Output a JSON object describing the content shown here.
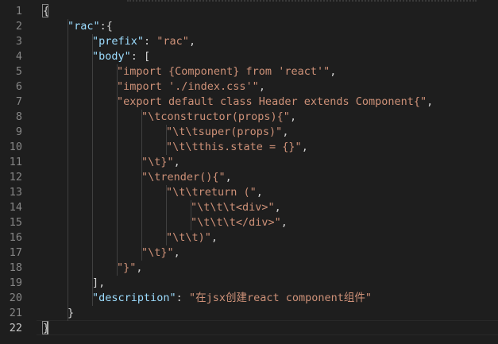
{
  "editor": {
    "line_numbers": [
      "1",
      "2",
      "3",
      "4",
      "5",
      "6",
      "7",
      "8",
      "9",
      "10",
      "11",
      "12",
      "13",
      "14",
      "15",
      "16",
      "17",
      "18",
      "19",
      "20",
      "21",
      "22"
    ],
    "active_line": "22",
    "lines": [
      {
        "indent": 0,
        "tokens": [
          {
            "t": "{",
            "c": "p"
          }
        ]
      },
      {
        "indent": 1,
        "tokens": [
          {
            "t": "\"rac\"",
            "c": "k"
          },
          {
            "t": ":{",
            "c": "p"
          }
        ]
      },
      {
        "indent": 2,
        "tokens": [
          {
            "t": "\"prefix\"",
            "c": "k"
          },
          {
            "t": ": ",
            "c": "p"
          },
          {
            "t": "\"rac\"",
            "c": "s"
          },
          {
            "t": ",",
            "c": "p"
          }
        ]
      },
      {
        "indent": 2,
        "tokens": [
          {
            "t": "\"body\"",
            "c": "k"
          },
          {
            "t": ": [",
            "c": "p"
          }
        ]
      },
      {
        "indent": 3,
        "tokens": [
          {
            "t": "\"import {Component} from 'react'\"",
            "c": "s"
          },
          {
            "t": ",",
            "c": "p"
          }
        ]
      },
      {
        "indent": 3,
        "tokens": [
          {
            "t": "\"import './index.css'\"",
            "c": "s"
          },
          {
            "t": ",",
            "c": "p"
          }
        ]
      },
      {
        "indent": 3,
        "tokens": [
          {
            "t": "\"export default class Header extends Component{\"",
            "c": "s"
          },
          {
            "t": ",",
            "c": "p"
          }
        ]
      },
      {
        "indent": 4,
        "tokens": [
          {
            "t": "\"\\tconstructor(props){\"",
            "c": "s"
          },
          {
            "t": ",",
            "c": "p"
          }
        ]
      },
      {
        "indent": 5,
        "tokens": [
          {
            "t": "\"\\t\\tsuper(props)\"",
            "c": "s"
          },
          {
            "t": ",",
            "c": "p"
          }
        ]
      },
      {
        "indent": 5,
        "tokens": [
          {
            "t": "\"\\t\\tthis.state = {}\"",
            "c": "s"
          },
          {
            "t": ",",
            "c": "p"
          }
        ]
      },
      {
        "indent": 4,
        "tokens": [
          {
            "t": "\"\\t}\"",
            "c": "s"
          },
          {
            "t": ",",
            "c": "p"
          }
        ]
      },
      {
        "indent": 4,
        "tokens": [
          {
            "t": "\"\\trender(){\"",
            "c": "s"
          },
          {
            "t": ",",
            "c": "p"
          }
        ]
      },
      {
        "indent": 5,
        "tokens": [
          {
            "t": "\"\\t\\treturn (\"",
            "c": "s"
          },
          {
            "t": ",",
            "c": "p"
          }
        ]
      },
      {
        "indent": 6,
        "tokens": [
          {
            "t": "\"\\t\\t\\t<div>\"",
            "c": "s"
          },
          {
            "t": ",",
            "c": "p"
          }
        ]
      },
      {
        "indent": 6,
        "tokens": [
          {
            "t": "\"\\t\\t\\t</div>\"",
            "c": "s"
          },
          {
            "t": ",",
            "c": "p"
          }
        ]
      },
      {
        "indent": 5,
        "tokens": [
          {
            "t": "\"\\t\\t)\"",
            "c": "s"
          },
          {
            "t": ",",
            "c": "p"
          }
        ]
      },
      {
        "indent": 4,
        "tokens": [
          {
            "t": "\"\\t}\"",
            "c": "s"
          },
          {
            "t": ",",
            "c": "p"
          }
        ]
      },
      {
        "indent": 3,
        "tokens": [
          {
            "t": "\"}\"",
            "c": "s"
          },
          {
            "t": ",",
            "c": "p"
          }
        ]
      },
      {
        "indent": 2,
        "tokens": [
          {
            "t": "],",
            "c": "p"
          }
        ]
      },
      {
        "indent": 2,
        "tokens": [
          {
            "t": "\"description\"",
            "c": "k"
          },
          {
            "t": ": ",
            "c": "p"
          },
          {
            "t": "\"在jsx创建react component组件\"",
            "c": "s"
          }
        ]
      },
      {
        "indent": 1,
        "tokens": [
          {
            "t": "}",
            "c": "p"
          }
        ]
      },
      {
        "indent": 0,
        "tokens": [
          {
            "t": "}",
            "c": "p"
          }
        ]
      }
    ]
  },
  "colors": {
    "background": "#1e1e1e",
    "line_number": "#858585",
    "punctuation": "#d4d4d4",
    "property_key": "#9cdcfe",
    "string": "#ce9178",
    "indent_guide": "#404040"
  }
}
